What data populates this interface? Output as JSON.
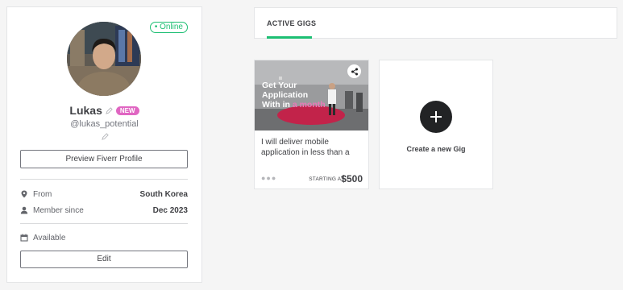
{
  "profile": {
    "online_label": "• Online",
    "name": "Lukas",
    "new_badge": "NEW",
    "username": "@lukas_potential",
    "preview_button": "Preview Fiverr Profile",
    "info": [
      {
        "icon": "location-pin-icon",
        "label": "From",
        "value": "South Korea"
      },
      {
        "icon": "user-icon",
        "label": "Member since",
        "value": "Dec 2023"
      }
    ],
    "availability": {
      "icon": "calendar-icon",
      "label": "Available"
    },
    "edit_button": "Edit"
  },
  "tabs": {
    "active_label": "ACTIVE GIGS"
  },
  "gigs": [
    {
      "thumb_line1": "Get Your",
      "thumb_line2": "Application",
      "thumb_line3_prefix": "With in ",
      "thumb_line3_highlight": "a month",
      "title": "I will deliver mobile application in less than a",
      "starting_at_label": "STARTING AT",
      "price": "$500",
      "menu_icon": "more-dots-icon",
      "share_icon": "share-icon"
    }
  ],
  "create_gig": {
    "label": "Create a new Gig",
    "icon": "plus-icon"
  },
  "colors": {
    "accent_green": "#1dbf73",
    "new_badge_pink": "#e066c2",
    "dark_button": "#222325"
  }
}
